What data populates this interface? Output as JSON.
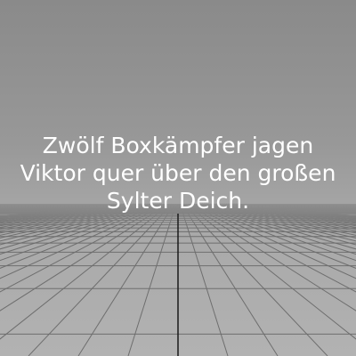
{
  "caption": {
    "lines": [
      "Zwölf Boxkämpfer jagen",
      "Viktor quer über den großen",
      "Sylter Deich."
    ]
  },
  "colors": {
    "text": "#ffffff",
    "grid": "#6e6e6e",
    "center_line": "#1a1a1a"
  }
}
